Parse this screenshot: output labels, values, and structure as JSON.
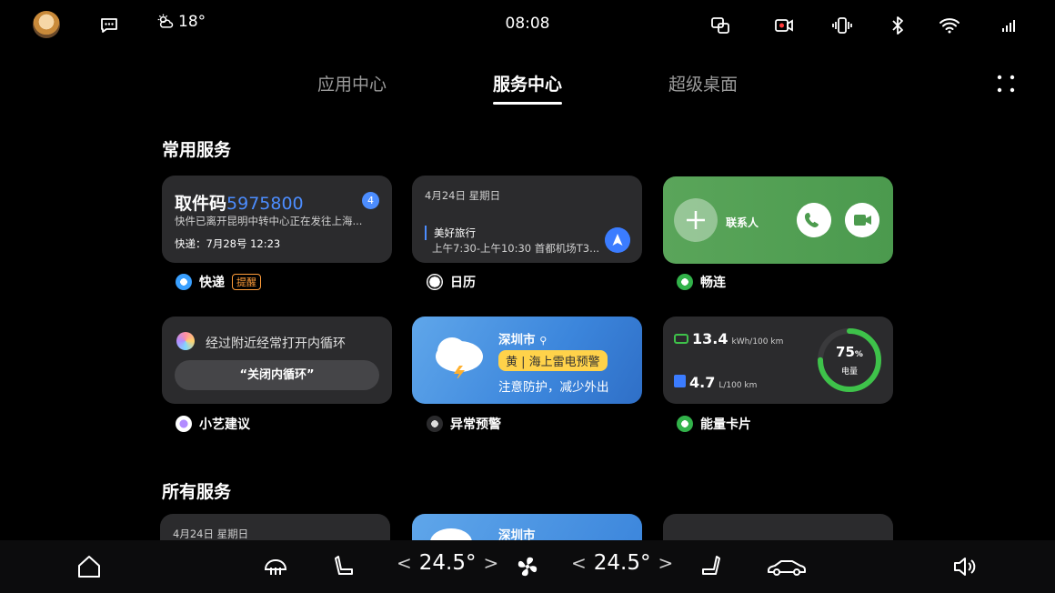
{
  "status_bar": {
    "weather_icon": "partly-cloudy-icon",
    "temperature": "18°",
    "time": "08:08",
    "icons": [
      "message-icon",
      "screen-mirror-icon",
      "record-icon",
      "vibrate-icon",
      "bluetooth-icon",
      "wifi-icon",
      "signal-icon"
    ]
  },
  "tabs": [
    {
      "label": "应用中心",
      "active": false
    },
    {
      "label": "服务中心",
      "active": true
    },
    {
      "label": "超级桌面",
      "active": false
    }
  ],
  "sections": {
    "common": "常用服务",
    "all": "所有服务"
  },
  "cards": {
    "express": {
      "title_prefix": "取件码",
      "code": "5975800",
      "badge": "4",
      "subtitle": "快件已离开昆明中转中心正在发往上海...",
      "footer": "快递：7月28号 12:23",
      "label": "快递",
      "tag": "提醒"
    },
    "calendar": {
      "date": "4月24日 星期日",
      "event": "美好旅行",
      "time": "上午7:30-上午10:30 首都机场T3...",
      "label": "日历"
    },
    "connect": {
      "contact_label": "联系人",
      "label": "畅连"
    },
    "suggest": {
      "text": "经过附近经常打开内循环",
      "button": "“关闭内循环”",
      "label": "小艺建议"
    },
    "warning": {
      "city": "深圳市",
      "warning": "黄 | 海上雷电预警",
      "tip": "注意防护，减少外出",
      "label": "异常预警"
    },
    "energy": {
      "power_value": "13.4",
      "power_unit": "kWh/100 km",
      "fuel_value": "4.7",
      "fuel_unit": "L/100 km",
      "battery_pct": "75",
      "battery_sign": "%",
      "battery_label": "电量",
      "battery_level": 0.75,
      "label": "能量卡片"
    }
  },
  "bottom_cards": {
    "calendar_date": "4月24日 星期日",
    "city": "深圳市"
  },
  "dock": {
    "temp_left": "24.5°",
    "temp_right": "24.5°",
    "arrow_left": "<",
    "arrow_right": ">"
  },
  "colors": {
    "accent_blue": "#4c8dff",
    "connect_green": "#55a155",
    "warning_yellow": "#ffd24a",
    "battery_green": "#3ec24a",
    "tag_orange": "#ff9d3a"
  }
}
